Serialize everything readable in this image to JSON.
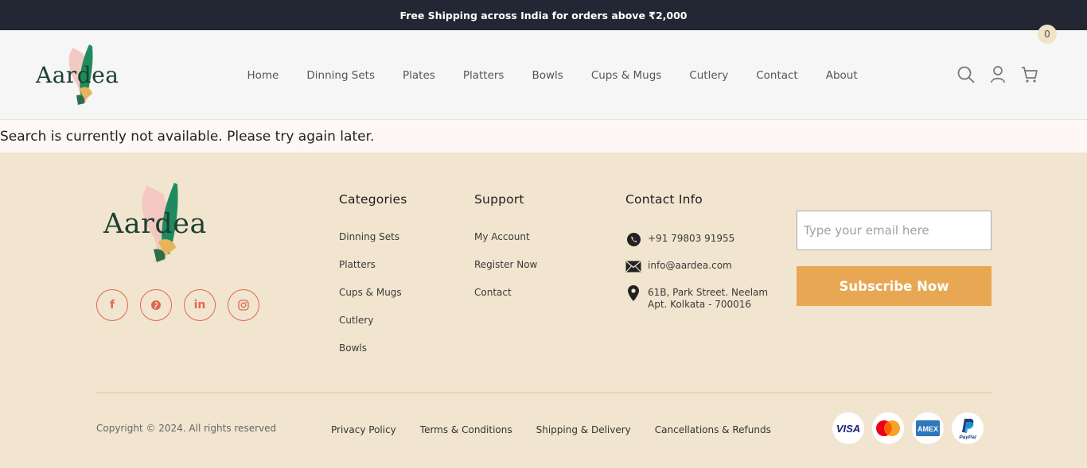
{
  "topbar": {
    "text": "Free Shipping across India for orders above ₹2,000"
  },
  "brand": {
    "name": "Aardea"
  },
  "nav": [
    {
      "label": "Home"
    },
    {
      "label": "Dinning Sets"
    },
    {
      "label": "Plates"
    },
    {
      "label": "Platters"
    },
    {
      "label": "Bowls"
    },
    {
      "label": "Cups & Mugs"
    },
    {
      "label": "Cutlery"
    },
    {
      "label": "Contact"
    },
    {
      "label": "About"
    }
  ],
  "header_icons": {
    "search": "search-icon",
    "account": "user-icon",
    "cart": "cart-icon",
    "cart_count": "0"
  },
  "message": "Search is currently not available. Please try again later.",
  "footer": {
    "socials": [
      {
        "icon": "facebook-icon",
        "glyph": "f"
      },
      {
        "icon": "pinterest-icon",
        "glyph": "℗"
      },
      {
        "icon": "linkedin-icon",
        "glyph": "in"
      },
      {
        "icon": "instagram-icon",
        "glyph": "◎"
      }
    ],
    "categories": {
      "title": "Categories",
      "links": [
        "Dinning Sets",
        "Platters",
        "Cups & Mugs",
        "Cutlery",
        "Bowls"
      ]
    },
    "support": {
      "title": "Support",
      "links": [
        "My Account",
        "Register Now",
        "Contact"
      ]
    },
    "contact": {
      "title": "Contact Info",
      "phone": "+91 79803 91955",
      "email": "info@aardea.com",
      "address": "61B, Park Street. Neelam Apt. Kolkata - 700016"
    },
    "newsletter": {
      "placeholder": "Type your email here",
      "button": "Subscribe Now"
    },
    "copyright": "Copyright © 2024. All rights reserved",
    "legal": [
      "Privacy Policy",
      "Terms & Conditions",
      "Shipping & Delivery",
      "Cancellations & Refunds"
    ],
    "payments": [
      {
        "icon": "visa-icon",
        "label": "VISA"
      },
      {
        "icon": "mastercard-icon",
        "label": "MasterCard"
      },
      {
        "icon": "amex-icon",
        "label": "AMEX"
      },
      {
        "icon": "paypal-icon",
        "label": "PayPal"
      }
    ]
  },
  "colors": {
    "topbar": "#232733",
    "footer_bg": "#f1e5cf",
    "accent": "#e8a752",
    "social": "#e0664f",
    "brand_green": "#1d4030"
  }
}
